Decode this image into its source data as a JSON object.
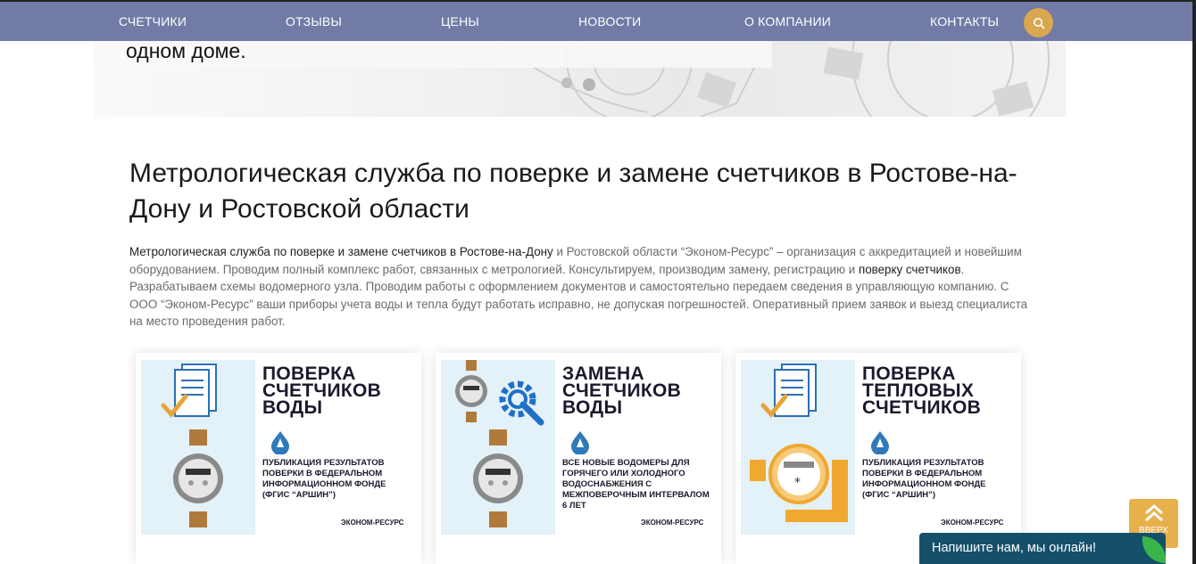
{
  "nav": {
    "items": [
      "СЧЕТЧИКИ",
      "ОТЗЫВЫ",
      "ЦЕНЫ",
      "НОВОСТИ",
      "О КОМПАНИИ",
      "КОНТАКТЫ"
    ],
    "search_icon": "search-icon"
  },
  "hero": {
    "text": "одном доме."
  },
  "main": {
    "title": "Метрологическая служба по поверке и замене счетчиков в Ростове-на-Дону и Ростовской области",
    "desc_bold_1": "Метрологическая служба по поверке и замене счетчиков в Ростове-на-Дону",
    "desc_part_1": " и Ростовской области “Эконом-Ресурс” – организация с аккредитацией и новейшим оборудованием. Проводим полный комплекс работ, связанных с метрологией. Консультируем, производим замену, регистрацию и ",
    "desc_bold_2": "поверку счетчиков",
    "desc_part_2": ". Разрабатываем схемы водомерного узла. Проводим работы с оформлением документов и самостоятельно передаем сведения в управляющую компанию. С ООО “Эконом-Ресурс” ваши приборы учета воды и тепла будут работать исправно, не допуская погрешностей. Оперативный прием заявок и выезд специалиста на место проведения работ."
  },
  "cards": [
    {
      "title": "Поверка счетчиков воды",
      "text": "Публикация результатов поверки в Федеральном информационном фонде (ФГИС “АРШИН”)",
      "brand": "Эконом-Ресурс"
    },
    {
      "title": "Замена счетчиков воды",
      "text": "Все новые водомеры для горячего или холодного водоснабжения с межповерочным интервалом 6 лет",
      "brand": "Эконом-Ресурс"
    },
    {
      "title": "Поверка тепловых счетчиков",
      "text": "Публикация результатов поверки в Федеральном информационном фонде (ФГИС “АРШИН”)",
      "brand": "Эконом-Ресурс"
    }
  ],
  "up_button": {
    "label": "ВВЕРХ"
  },
  "chat": {
    "label": "Напишите нам, мы онлайн!"
  },
  "colors": {
    "nav_bg": "#717ba6",
    "accent": "#d9a74f",
    "chat_bg": "#15506b",
    "card_bg": "#e3f1f8"
  }
}
